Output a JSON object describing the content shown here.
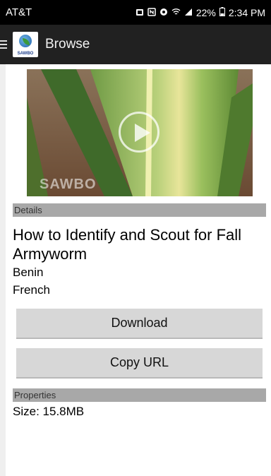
{
  "status_bar": {
    "carrier": "AT&T",
    "battery_percent": "22%",
    "time": "2:34 PM",
    "icons": [
      "alarm-icon",
      "nfc-icon",
      "notification-icon",
      "wifi-icon",
      "signal-icon",
      "battery-icon"
    ]
  },
  "app_bar": {
    "title": "Browse",
    "logo_text": "SAWBO"
  },
  "video": {
    "watermark": "SAWBO"
  },
  "details": {
    "section_label": "Details",
    "title": "How to Identify and Scout for Fall Armyworm",
    "country": "Benin",
    "language": "French"
  },
  "buttons": {
    "download": "Download",
    "copy_url": "Copy URL"
  },
  "properties": {
    "section_label": "Properties",
    "size_label": "Size:",
    "size_value": "15.8MB"
  }
}
